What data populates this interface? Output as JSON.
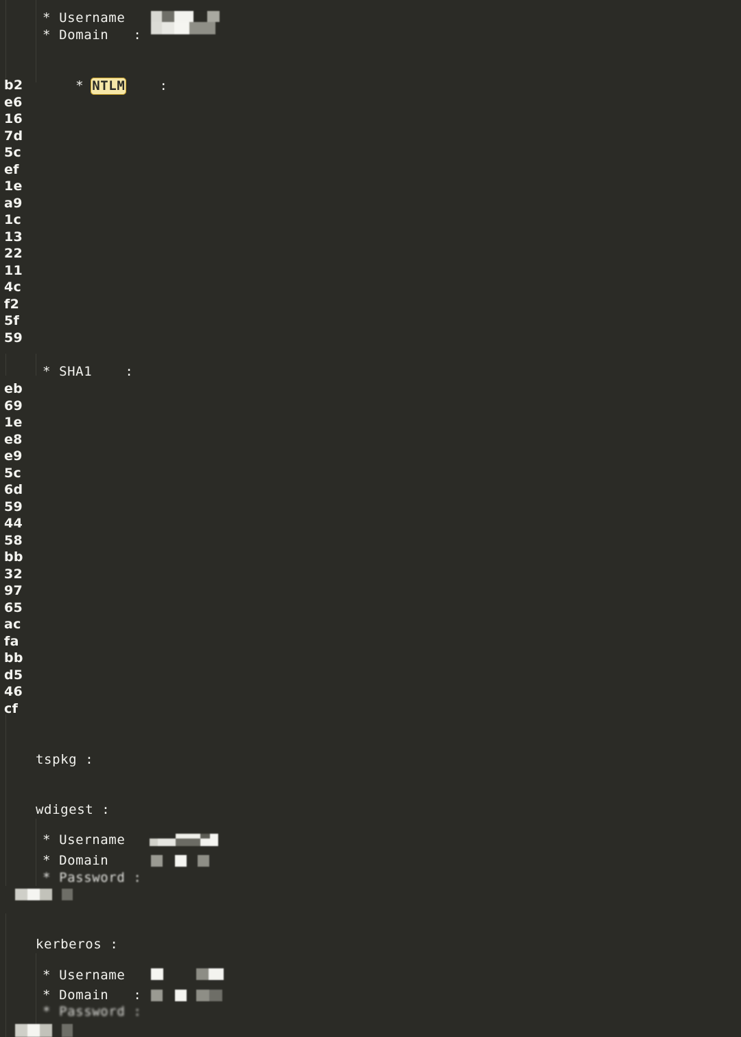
{
  "terminal": {
    "background_color": "#2b2b26",
    "text_color": "#f2f2ee",
    "guide_color": "#3d3d36",
    "highlight_bg_color": "#f6e7a8",
    "highlight_border_color": "#c9a227",
    "highlight_text_color": "#2b2b26",
    "redaction_color_light": "#f3f3ef",
    "redaction_color_mid": "#b9b9b1",
    "redaction_color_dark": "#7d7d75"
  },
  "msv": {
    "username_label": "* Username",
    "domain_label": "* Domain   :",
    "ntlm_label_star": "* ",
    "ntlm_label": "NTLM",
    "ntlm_colon": "    :",
    "sha1_label": "* SHA1    :",
    "ntlm_hash_bytes": [
      "b2",
      "e6",
      "16",
      "7d",
      "5c",
      "ef",
      "1e",
      "a9",
      "1c",
      "13",
      "22",
      "11",
      "4c",
      "f2",
      "5f",
      "59"
    ],
    "sha1_hash_bytes": [
      "eb",
      "69",
      "1e",
      "e8",
      "e9",
      "5c",
      "6d",
      "59",
      "44",
      "58",
      "bb",
      "32",
      "97",
      "65",
      "ac",
      "fa",
      "bb",
      "d5",
      "46",
      "cf"
    ]
  },
  "packages": [
    {
      "name": "tspkg :",
      "fields": []
    },
    {
      "name": "wdigest :",
      "fields": [
        {
          "label": "* Username",
          "redacted": true
        },
        {
          "label": "* Domain  ",
          "redacted": true
        },
        {
          "label": "* Password :",
          "redacted": true
        }
      ]
    },
    {
      "name": "kerberos :",
      "fields": [
        {
          "label": "* Username",
          "redacted": true
        },
        {
          "label": "* Domain   :",
          "redacted": true
        },
        {
          "label": "* Password :",
          "redacted": true
        }
      ]
    }
  ],
  "redaction_note": "values obscured by pixelation"
}
